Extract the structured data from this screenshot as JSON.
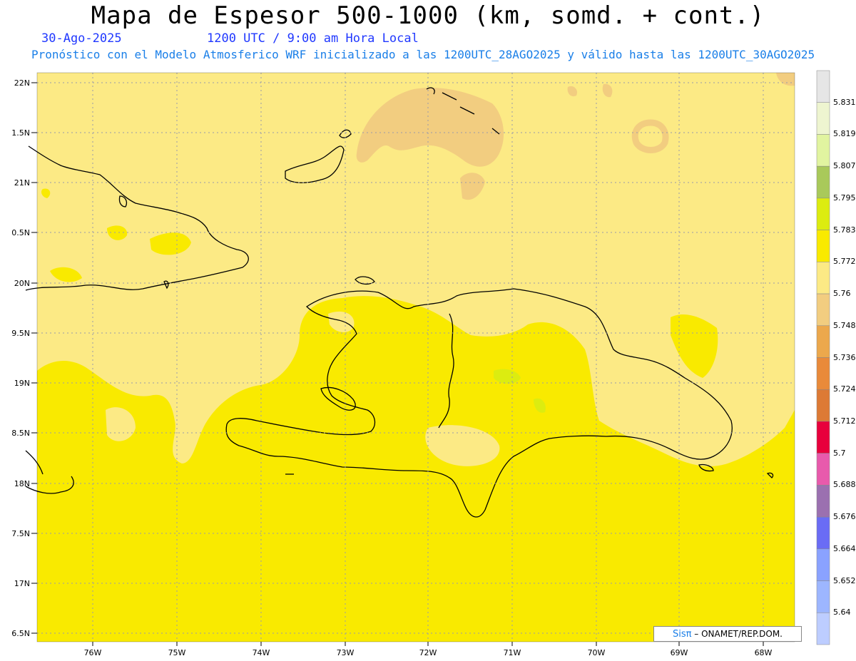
{
  "header": {
    "title": "Mapa de Espesor 500-1000 (km, somd. + cont.)",
    "date": "30-Ago-2025",
    "time": "1200 UTC / 9:00 am Hora Local",
    "subtitle": "Pronóstico con el Modelo Atmosferico WRF inicializado a las 1200UTC_28AGO2025 y válido hasta las  1200UTC_30AGO2025"
  },
  "axes": {
    "lat_labels": [
      "22N",
      "1.5N",
      "21N",
      "0.5N",
      "20N",
      "9.5N",
      "19N",
      "8.5N",
      "18N",
      "7.5N",
      "17N",
      "6.5N"
    ],
    "lon_labels": [
      "76W",
      "75W",
      "74W",
      "73W",
      "72W",
      "71W",
      "70W",
      "69W",
      "68W"
    ]
  },
  "colorbar": {
    "levels": [
      "5.831",
      "5.819",
      "5.807",
      "5.795",
      "5.783",
      "5.772",
      "5.76",
      "5.748",
      "5.736",
      "5.724",
      "5.712",
      "5.7",
      "5.688",
      "5.676",
      "5.664",
      "5.652",
      "5.64"
    ],
    "colors": [
      "#e6e6e6",
      "#eef5d0",
      "#e1f4a0",
      "#a9c95a",
      "#dcec10",
      "#f9ea00",
      "#fcea85",
      "#f2cd80",
      "#eca84c",
      "#e98a3a",
      "#dd7a35",
      "#e8003c",
      "#e85aac",
      "#9b70b0",
      "#6a6cf5",
      "#8aa2ff",
      "#9db6ff",
      "#bdcdff"
    ]
  },
  "credit": {
    "brand": "Sisπ",
    "text": "– ONAMET/REP.DOM."
  }
}
